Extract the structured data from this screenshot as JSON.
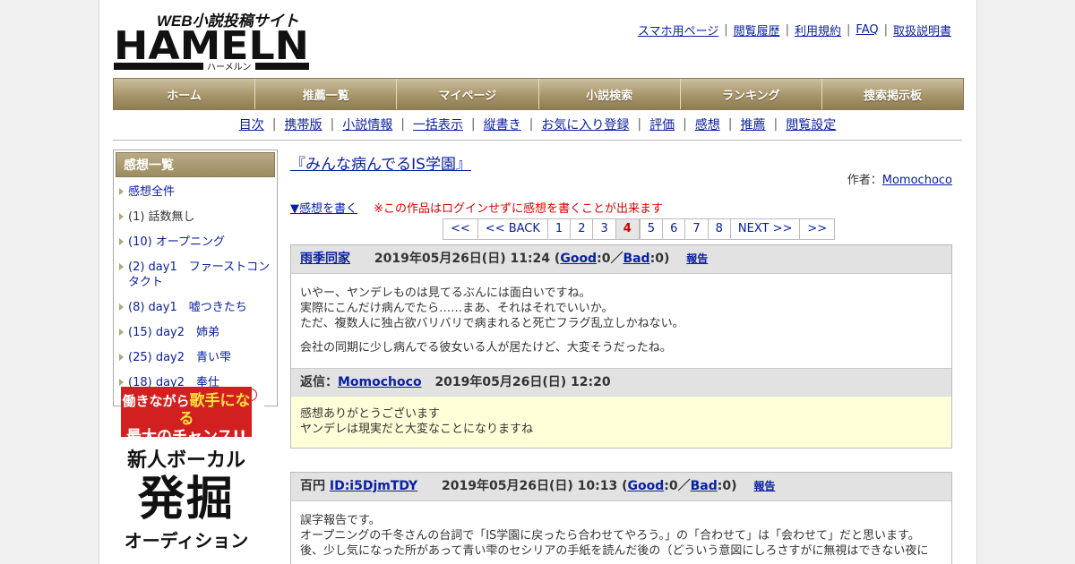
{
  "site": {
    "logo_text": "HAMELN",
    "logo_sub": "WEB小説投稿サイト",
    "logo_kana": "ハーメルン"
  },
  "top_links": [
    "スマホ用ページ",
    "閲覧履歴",
    "利用規約",
    "FAQ",
    "取扱説明書"
  ],
  "global_nav": [
    "ホーム",
    "推薦一覧",
    "マイページ",
    "小説検索",
    "ランキング",
    "捜索掲示板"
  ],
  "sub_nav": [
    "目次",
    "携帯版",
    "小説情報",
    "一括表示",
    "縦書き",
    "お気に入り登録",
    "評価",
    "感想",
    "推薦",
    "閲覧設定"
  ],
  "sidebar": {
    "title": "感想一覧",
    "items": [
      {
        "label": "感想全件",
        "link": true
      },
      {
        "label": "(1) 話数無し",
        "link": false
      },
      {
        "label": "(10) オープニング",
        "link": true
      },
      {
        "label": "(2) day1　ファーストコンタクト",
        "link": true
      },
      {
        "label": "(8) day1　嘘つきたち",
        "link": true
      },
      {
        "label": "(15) day2　姉弟",
        "link": true
      },
      {
        "label": "(25) day2　青い雫",
        "link": true
      },
      {
        "label": "(18) day2　奉仕",
        "link": true
      }
    ]
  },
  "ad": {
    "line_a": "働きながら",
    "line_a_hi": "歌手になる",
    "line_b": "最大のチャンス!!",
    "line_c": "新人ボーカル",
    "line_d": "発掘",
    "line_e": "オーディション",
    "info": "i"
  },
  "main": {
    "work_title": "『みんな病んでるIS学園』",
    "author_label": "作者：",
    "author_name": "Momochoco",
    "write_link": "▼感想を書く",
    "warning": "※この作品はログインせずに感想を書くことが出来ます",
    "pager": [
      "<<",
      "<< BACK",
      "1",
      "2",
      "3",
      "4",
      "5",
      "6",
      "7",
      "8",
      "NEXT >>",
      ">>"
    ],
    "pager_current": "4",
    "comments": [
      {
        "user": "雨季同家",
        "user_prefix": "",
        "date": "2019年05月26日(日) 11:24",
        "good_label": "Good",
        "good": "0",
        "bad_label": "Bad",
        "bad": "0",
        "report": "報告",
        "body": [
          "いやー、ヤンデレものは見てるぶんには面白いですね。\n実際にこんだけ病んでたら……まあ、それはそれでいいか。\nただ、複数人に独占欲バリバリで病まれると死亡フラグ乱立しかねない。",
          "会社の同期に少し病んでる彼女いる人が居たけど、大変そうだったね。"
        ],
        "reply": {
          "label": "返信：",
          "name": "Momochoco",
          "date": "2019年05月26日(日) 12:20",
          "body": "感想ありがとうございます\nヤンデレは現実だと大変なことになりますね"
        }
      },
      {
        "user_prefix": "百円",
        "user": "ID:i5DjmTDY",
        "date": "2019年05月26日(日) 10:13",
        "good_label": "Good",
        "good": "0",
        "bad_label": "Bad",
        "bad": "0",
        "report": "報告",
        "body": [
          "誤字報告です。\nオープニングの千冬さんの台詞で「IS学園に戻ったら合わせてやろう。」の「合わせて」は「会わせて」だと思います。\n後、少し気になった所があって青い雫のセシリアの手紙を読んだ後の（どういう意図にしろさすがに無視はできない夜に"
        ]
      }
    ]
  }
}
